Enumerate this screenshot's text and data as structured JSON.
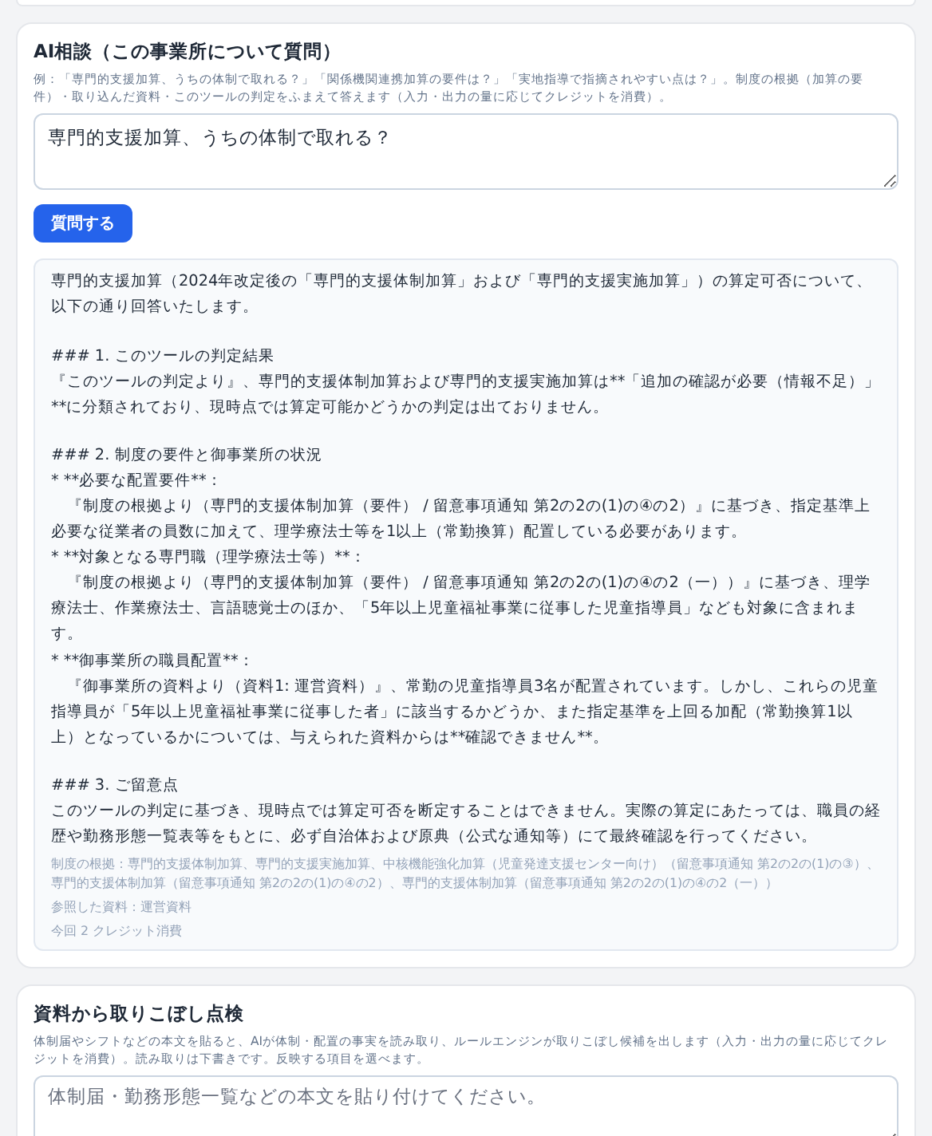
{
  "consult": {
    "title": "AI相談（この事業所について質問）",
    "hint": "例：「専門的支援加算、うちの体制で取れる？」「関係機関連携加算の要件は？」「実地指導で指摘されやすい点は？」。制度の根拠（加算の要件）・取り込んだ資料・このツールの判定をふまえて答えます（入力・出力の量に応じてクレジットを消費）。",
    "question": {
      "value": "専門的支援加算、うちの体制で取れる？"
    },
    "ask_button": "質問する",
    "answer": {
      "blocks": [
        [
          "専門的支援加算（2024年改定後の「専門的支援体制加算」および「専門的支援実施加算」）の算定可否について、以下の通り回答いたします。"
        ],
        [
          "### 1. このツールの判定結果",
          "『このツールの判定より』、専門的支援体制加算および専門的支援実施加算は**「追加の確認が必要（情報不足）」**に分類されており、現時点では算定可能かどうかの判定は出ておりません。"
        ],
        [
          "### 2. 制度の要件と御事業所の状況",
          "* **必要な配置要件**：",
          "　『制度の根拠より（専門的支援体制加算（要件） / 留意事項通知 第2の2の(1)の④の2）』に基づき、指定基準上必要な従業者の員数に加えて、理学療法士等を1以上（常勤換算）配置している必要があります。",
          "* **対象となる専門職（理学療法士等）**：",
          "　『制度の根拠より（専門的支援体制加算（要件） / 留意事項通知 第2の2の(1)の④の2（一））』に基づき、理学療法士、作業療法士、言語聴覚士のほか、「5年以上児童福祉事業に従事した児童指導員」なども対象に含まれます。",
          "* **御事業所の職員配置**：",
          "　『御事業所の資料より（資料1: 運営資料）』、常勤の児童指導員3名が配置されています。しかし、これらの児童指導員が「5年以上児童福祉事業に従事した者」に該当するかどうか、また指定基準を上回る加配（常勤換算1以上）となっているかについては、与えられた資料からは**確認できません**。"
        ],
        [
          "### 3. ご留意点",
          "このツールの判定に基づき、現時点では算定可否を断定することはできません。実際の算定にあたっては、職員の経歴や勤務形態一覧表等をもとに、必ず自治体および原典（公式な通知等）にて最終確認を行ってください。"
        ]
      ],
      "basis": "制度の根拠：専門的支援体制加算、専門的支援実施加算、中核機能強化加算（児童発達支援センター向け）（留意事項通知 第2の2の(1)の③）、専門的支援体制加算（留意事項通知 第2の2の(1)の④の2）、専門的支援体制加算（留意事項通知 第2の2の(1)の④の2（一））",
      "references": "参照した資料：運営資料",
      "credits": "今回 2 クレジット消費"
    }
  },
  "check": {
    "title": "資料から取りこぼし点検",
    "hint": "体制届やシフトなどの本文を貼ると、AIが体制・配置の事実を読み取り、ルールエンジンが取りこぼし候補を出します（入力・出力の量に応じてクレジットを消費）。読み取りは下書きです。反映する項目を選べます。",
    "source": {
      "placeholder": "体制届・勤務形態一覧などの本文を貼り付けてください。"
    }
  }
}
